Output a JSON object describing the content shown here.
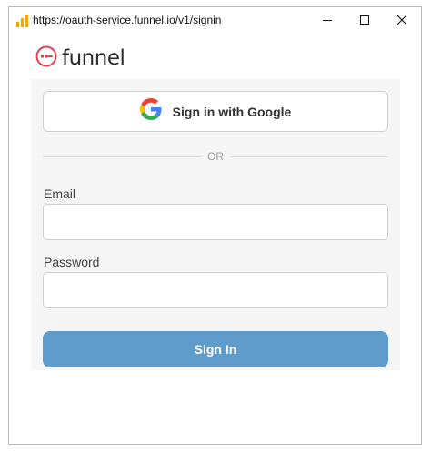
{
  "window": {
    "url": "https://oauth-service.funnel.io/v1/signin",
    "app_icon": "bar-chart-icon",
    "controls": [
      "minimize-icon",
      "maximize-icon",
      "close-icon"
    ]
  },
  "brand": {
    "name": "funnel",
    "logo_icon": "funnel-logo-icon",
    "accent_color": "#e0434b"
  },
  "form": {
    "google_button_label": "Sign in with Google",
    "google_icon": "google-g-icon",
    "divider_text": "OR",
    "email_label": "Email",
    "email_value": "",
    "password_label": "Password",
    "password_value": "",
    "submit_label": "Sign In",
    "submit_color": "#5f9ccb"
  }
}
